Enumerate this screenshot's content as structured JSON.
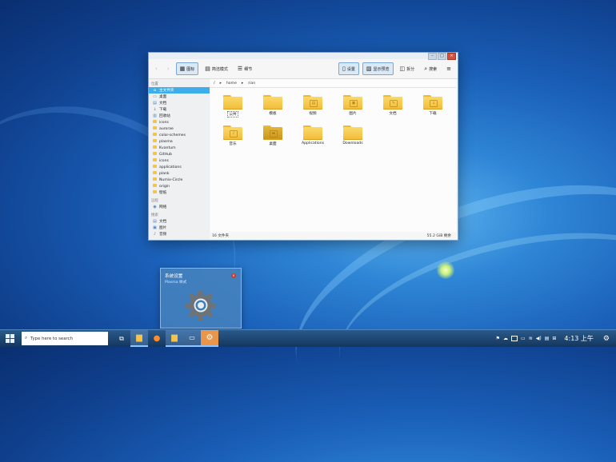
{
  "dolphin": {
    "toolbar": {
      "back": "‹",
      "forward": "›",
      "icons_view": "图标",
      "compact_view": "简洁模式",
      "details_view": "细节",
      "settings_toggle": "设置",
      "preview_toggle": "显示预览",
      "split": "拆分",
      "search": "搜索"
    },
    "sidebar": {
      "places_title": "位置",
      "places": [
        {
          "label": "主文件夹",
          "icon": "home-icon"
        },
        {
          "label": "桌面",
          "icon": "desktop-icon"
        },
        {
          "label": "文档",
          "icon": "documents-icon"
        },
        {
          "label": "下载",
          "icon": "download-icon"
        },
        {
          "label": "回收站",
          "icon": "trash-icon"
        },
        {
          "label": "icons",
          "icon": "folder-icon"
        },
        {
          "label": "aurorae",
          "icon": "folder-icon"
        },
        {
          "label": "color-schemes",
          "icon": "folder-icon"
        },
        {
          "label": "plasma",
          "icon": "folder-icon"
        },
        {
          "label": "Kvantum",
          "icon": "folder-icon"
        },
        {
          "label": "GitHub",
          "icon": "folder-icon"
        },
        {
          "label": "icons",
          "icon": "folder-icon"
        },
        {
          "label": "applications",
          "icon": "folder-icon"
        },
        {
          "label": "plank",
          "icon": "folder-icon"
        },
        {
          "label": "Numix-Circle",
          "icon": "folder-icon"
        },
        {
          "label": "origin",
          "icon": "folder-icon"
        },
        {
          "label": "壁纸",
          "icon": "folder-icon"
        }
      ],
      "remote_title": "远程",
      "remote": [
        {
          "label": "网络",
          "icon": "network-icon"
        }
      ],
      "recent_title": "搜索",
      "recent": [
        {
          "label": "文档",
          "icon": "documents-icon"
        },
        {
          "label": "图片",
          "icon": "images-icon"
        },
        {
          "label": "音频",
          "icon": "audio-icon"
        }
      ]
    },
    "breadcrumb": [
      "/",
      "home",
      "rian"
    ],
    "files": [
      {
        "name": "公共",
        "emblem": ""
      },
      {
        "name": "模板",
        "emblem": ""
      },
      {
        "name": "视频",
        "emblem": "▤"
      },
      {
        "name": "图片",
        "emblem": "▣"
      },
      {
        "name": "文档",
        "emblem": "✎"
      },
      {
        "name": "下载",
        "emblem": "↓"
      },
      {
        "name": "音乐",
        "emblem": "♪"
      },
      {
        "name": "桌面",
        "emblem": "▬"
      },
      {
        "name": "Applications",
        "emblem": ""
      },
      {
        "name": "Downloads",
        "emblem": ""
      }
    ],
    "status": {
      "count": "16 文件夹",
      "free": "55.2 GiB 剩余"
    }
  },
  "popup": {
    "title": "系统设置",
    "subtitle": "Plasma 样式"
  },
  "taskbar": {
    "search_placeholder": "Type here to search",
    "clock": "4:13 上午"
  }
}
